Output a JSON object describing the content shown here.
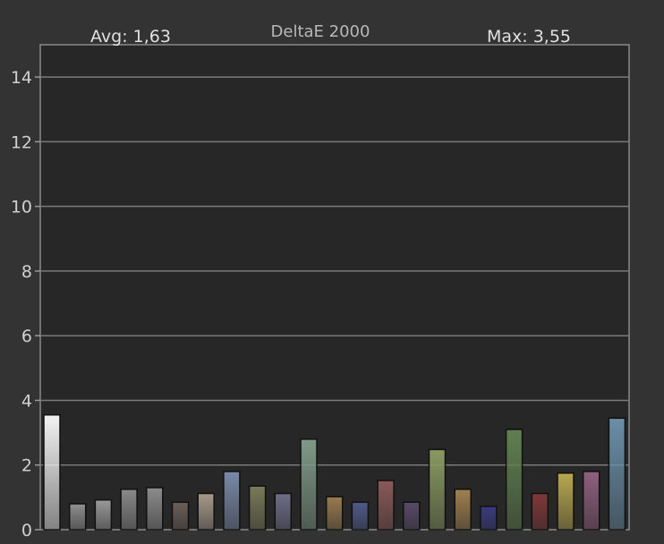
{
  "chart_data": {
    "type": "bar",
    "title": "DeltaE 2000",
    "avg_label": "Avg: 1,63",
    "max_label": "Max: 3,55",
    "xlabel": "",
    "ylabel": "",
    "ylim": [
      0,
      15
    ],
    "y_ticks": [
      "0",
      "2",
      "4",
      "6",
      "8",
      "10",
      "12",
      "14"
    ],
    "grid": true,
    "values": [
      3.55,
      0.8,
      0.92,
      1.25,
      1.3,
      0.85,
      1.12,
      1.8,
      1.35,
      1.12,
      2.8,
      1.02,
      0.85,
      1.52,
      0.85,
      2.48,
      1.25,
      0.72,
      3.1,
      1.12,
      1.75,
      1.8,
      3.45
    ],
    "bar_colors": [
      "#f2f2f2",
      "#8f8f8f",
      "#9a9a9a",
      "#8a8a8a",
      "#8c8c8c",
      "#6a5f58",
      "#a89a8a",
      "#7a8aa8",
      "#7a7a5a",
      "#6e6e88",
      "#7f9a88",
      "#9a7a50",
      "#505a8a",
      "#8a5a58",
      "#5a4a6a",
      "#8a9a60",
      "#a08050",
      "#3a3a80",
      "#608050",
      "#803838",
      "#b8a850",
      "#906080",
      "#6a8fa8"
    ]
  },
  "colors": {
    "background": "#333333",
    "plot_area": "#272727",
    "grid": "#7a7a7a",
    "text": "#d0d0d0"
  }
}
